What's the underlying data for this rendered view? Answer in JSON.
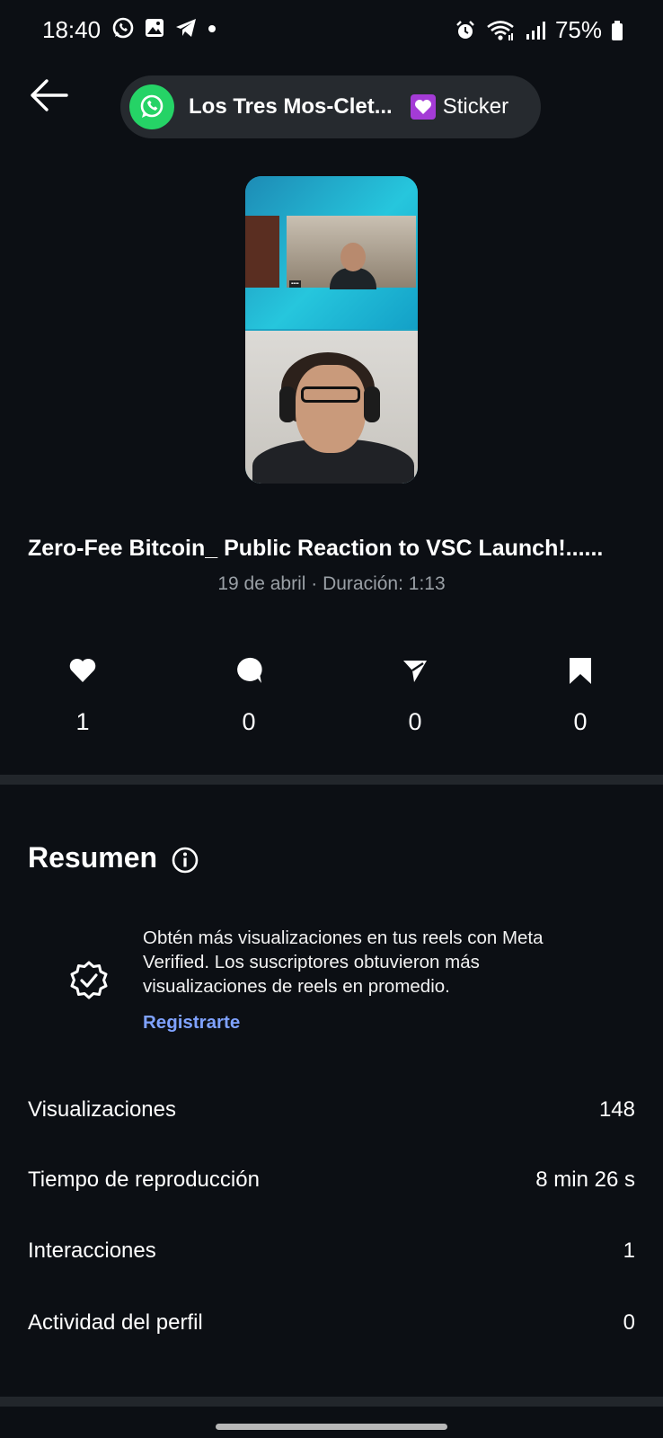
{
  "status_bar": {
    "time": "18:40",
    "battery": "75%",
    "left_icons": [
      "whatsapp-icon",
      "gallery-icon",
      "telegram-icon",
      "dot-icon"
    ],
    "right_icons": [
      "alarm-icon",
      "wifi-icon",
      "signal-icon",
      "battery-icon"
    ]
  },
  "sticker_pill": {
    "title": "Los Tres Mos-Clet...",
    "label": "Sticker"
  },
  "reel": {
    "title": "Zero-Fee Bitcoin_ Public Reaction to VSC Launch!......",
    "meta": "19 de abril · Duración: 1:13"
  },
  "engagement": {
    "likes": "1",
    "comments": "0",
    "shares": "0",
    "saves": "0"
  },
  "summary": {
    "title": "Resumen",
    "promo_text": "Obtén más visualizaciones en tus reels con Meta Verified. Los suscriptores obtuvieron más visualizaciones de reels en promedio.",
    "promo_link": "Registrarte",
    "metrics": [
      {
        "label": "Visualizaciones",
        "value": "148"
      },
      {
        "label": "Tiempo de reproducción",
        "value": "8 min 26 s"
      },
      {
        "label": "Interacciones",
        "value": "1"
      },
      {
        "label": "Actividad del perfil",
        "value": "0"
      }
    ]
  },
  "colors": {
    "background": "#0c0f14",
    "link": "#7fa2ff",
    "whatsapp": "#25D366"
  }
}
